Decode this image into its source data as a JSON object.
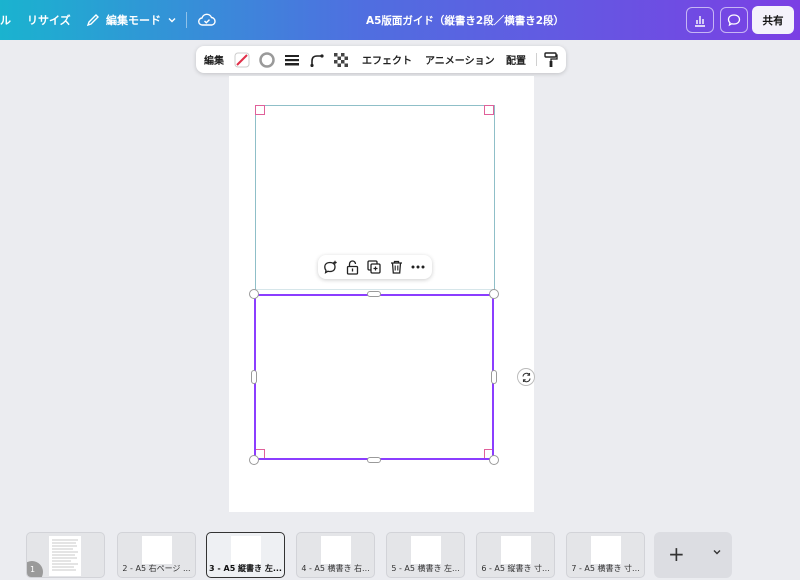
{
  "topbar": {
    "partial_left": "ル",
    "resize": "リサイズ",
    "edit_mode": "編集モード",
    "title": "A5版面ガイド（縦書き2段／横書き2段）",
    "share": "共有"
  },
  "context_toolbar": {
    "edit": "編集",
    "effects": "エフェクト",
    "animation": "アニメーション",
    "position": "配置"
  },
  "pages": [
    {
      "label": "",
      "number": "1"
    },
    {
      "label": "2 - A5 右ページ ..."
    },
    {
      "label": "3 - A5 縦書き 左...",
      "active": true
    },
    {
      "label": "4 - A5 横書き 右..."
    },
    {
      "label": "5 - A5 横書き 左..."
    },
    {
      "label": "6 - A5 縦書き 寸..."
    },
    {
      "label": "7 - A5 横書き 寸..."
    }
  ],
  "add_page": "+",
  "colors": {
    "accent": "#8b3dff",
    "guide": "#e0609a"
  }
}
